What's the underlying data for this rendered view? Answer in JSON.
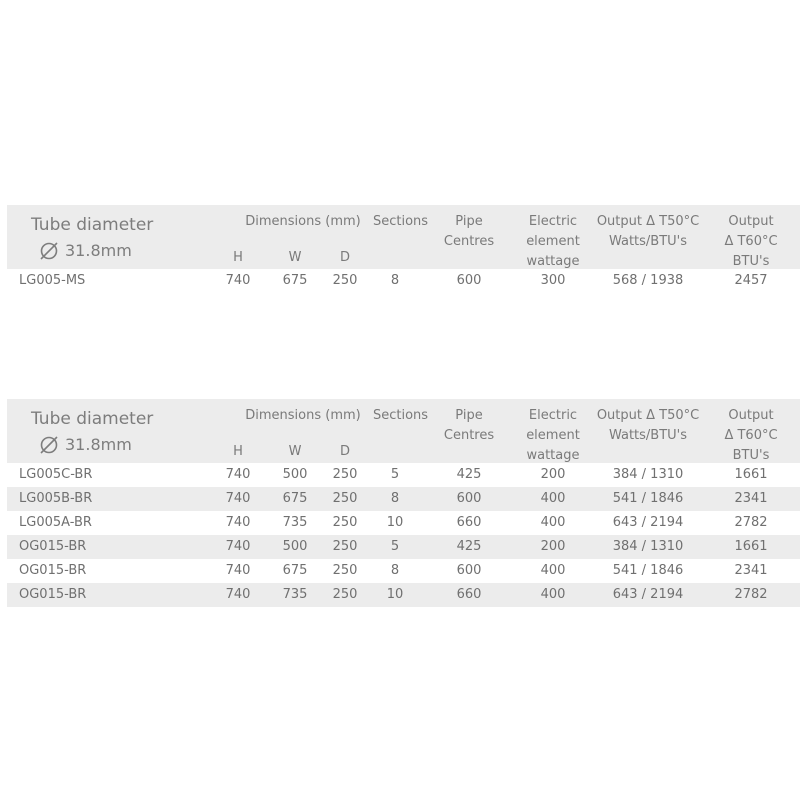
{
  "tables": [
    {
      "header": {
        "tube_title": "Tube diameter",
        "tube_dia": "31.8mm",
        "dimensions": "Dimensions (mm)",
        "h": "H",
        "w": "W",
        "d": "D",
        "sections": "Sections",
        "pipe_1": "Pipe",
        "pipe_2": "Centres",
        "elec_1": "Electric",
        "elec_2": "element",
        "elec_3": "wattage",
        "o50_1": "Output Δ T50°C",
        "o50_2": "Watts/BTU's",
        "o60_1": "Output",
        "o60_2": "Δ T60°C BTU's"
      },
      "rows": [
        {
          "model": "LG005-MS",
          "h": "740",
          "w": "675",
          "d": "250",
          "sections": "8",
          "pipe": "600",
          "elec": "300",
          "o50": "568 / 1938",
          "o60": "2457"
        }
      ]
    },
    {
      "header": {
        "tube_title": "Tube diameter",
        "tube_dia": "31.8mm",
        "dimensions": "Dimensions (mm)",
        "h": "H",
        "w": "W",
        "d": "D",
        "sections": "Sections",
        "pipe_1": "Pipe",
        "pipe_2": "Centres",
        "elec_1": "Electric",
        "elec_2": "element",
        "elec_3": "wattage",
        "o50_1": "Output Δ T50°C",
        "o50_2": "Watts/BTU's",
        "o60_1": "Output",
        "o60_2": "Δ T60°C BTU's"
      },
      "rows": [
        {
          "model": "LG005C-BR",
          "h": "740",
          "w": "500",
          "d": "250",
          "sections": "5",
          "pipe": "425",
          "elec": "200",
          "o50": "384 / 1310",
          "o60": "1661"
        },
        {
          "model": "LG005B-BR",
          "h": "740",
          "w": "675",
          "d": "250",
          "sections": "8",
          "pipe": "600",
          "elec": "400",
          "o50": "541 / 1846",
          "o60": "2341"
        },
        {
          "model": "LG005A-BR",
          "h": "740",
          "w": "735",
          "d": "250",
          "sections": "10",
          "pipe": "660",
          "elec": "400",
          "o50": "643 / 2194",
          "o60": "2782"
        },
        {
          "model": "OG015-BR",
          "h": "740",
          "w": "500",
          "d": "250",
          "sections": "5",
          "pipe": "425",
          "elec": "200",
          "o50": "384 / 1310",
          "o60": "1661"
        },
        {
          "model": "OG015-BR",
          "h": "740",
          "w": "675",
          "d": "250",
          "sections": "8",
          "pipe": "600",
          "elec": "400",
          "o50": "541 / 1846",
          "o60": "2341"
        },
        {
          "model": "OG015-BR",
          "h": "740",
          "w": "735",
          "d": "250",
          "sections": "10",
          "pipe": "660",
          "elec": "400",
          "o50": "643 / 2194",
          "o60": "2782"
        }
      ]
    }
  ]
}
